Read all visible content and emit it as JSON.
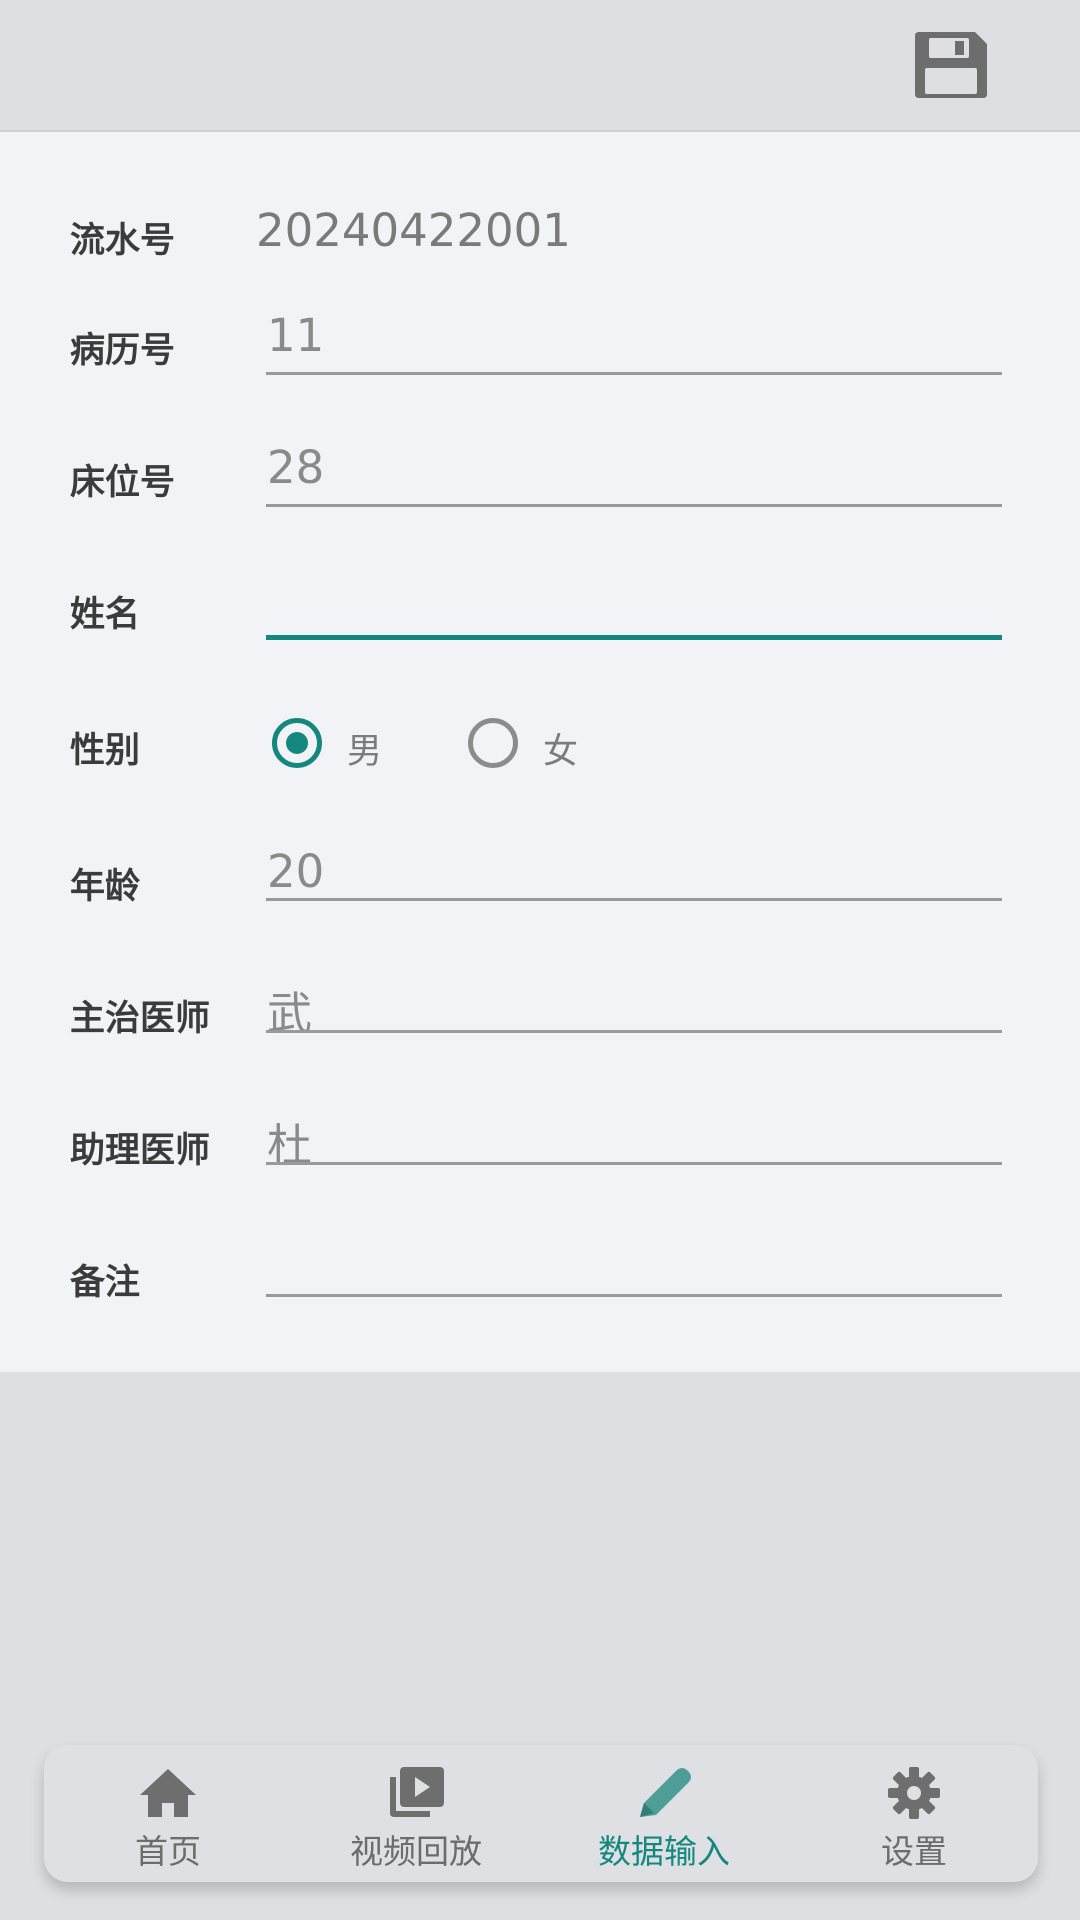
{
  "toolbar": {
    "save_icon": "floppy-disk-save-icon"
  },
  "form": {
    "serial": {
      "label": "流水号",
      "value": "20240422001"
    },
    "record": {
      "label": "病历号",
      "value": "11"
    },
    "bed": {
      "label": "床位号",
      "value": "28"
    },
    "name": {
      "label": "姓名",
      "value": ""
    },
    "gender": {
      "label": "性别",
      "options": [
        "男",
        "女"
      ],
      "selected": "男"
    },
    "age": {
      "label": "年龄",
      "value": "20"
    },
    "attending": {
      "label": "主治医师",
      "value": "武"
    },
    "assistant": {
      "label": "助理医师",
      "value": "杜"
    },
    "notes": {
      "label": "备注",
      "value": ""
    }
  },
  "nav": {
    "items": [
      {
        "label": "首页",
        "icon": "home-icon"
      },
      {
        "label": "视频回放",
        "icon": "video-library-icon"
      },
      {
        "label": "数据输入",
        "icon": "pencil-icon"
      },
      {
        "label": "设置",
        "icon": "gear-icon"
      }
    ],
    "active": "数据输入"
  },
  "colors": {
    "accent": "#14887f",
    "background": "#dedfe3",
    "form_background": "#f1f3f7",
    "label_text": "#3b3b3b",
    "value_text": "#8a8a8a"
  }
}
